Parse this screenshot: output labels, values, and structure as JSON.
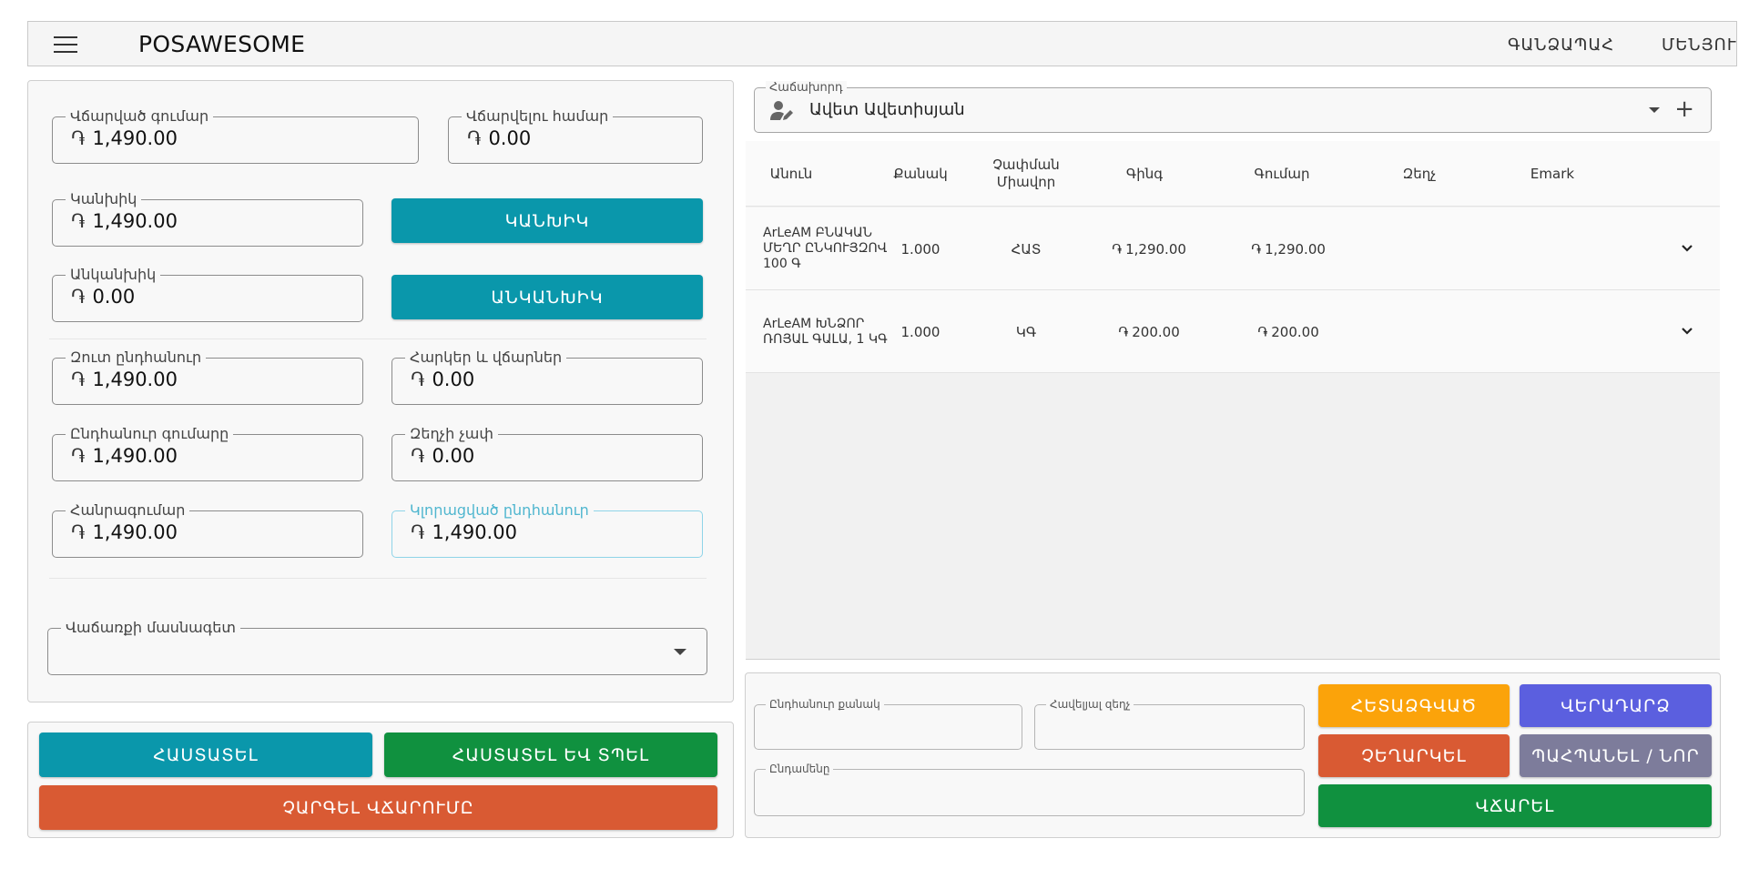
{
  "header": {
    "brand": "POSAWESOME",
    "nav": [
      "ԳԱՆՁԱՊԱՀ",
      "ՄԵՆՅՈՒ"
    ]
  },
  "payment": {
    "paid_amount": {
      "label": "Վճարված գումար",
      "value": "1,490.00"
    },
    "to_pay": {
      "label": "Վճարվելու համար",
      "value": "0.00"
    },
    "cash": {
      "label": "Կանխիկ",
      "value": "1,490.00",
      "button": "ԿԱՆԽԻԿ"
    },
    "noncash": {
      "label": "Անկանխիկ",
      "value": "0.00",
      "button": "ԱՆԿԱՆԽԻԿ"
    },
    "net_total": {
      "label": "Զուտ ընդհանուր",
      "value": "1,490.00"
    },
    "taxes": {
      "label": "Հարկեր և վճարներ",
      "value": "0.00"
    },
    "grand_total": {
      "label": "Ընդհանուր գումարը",
      "value": "1,490.00"
    },
    "discount": {
      "label": "Զեղչի չափ",
      "value": "0.00"
    },
    "total": {
      "label": "Հանրագումար",
      "value": "1,490.00"
    },
    "rounded_total": {
      "label": "Կլորացված ընդհանուր",
      "value": "1,490.00"
    },
    "salesperson": {
      "label": "Վաճառքի մասնագետ",
      "value": ""
    },
    "currency_symbol": "֏"
  },
  "payment_actions": {
    "submit": "ՀԱՍՏԱՏԵԼ",
    "submit_print": "ՀԱՍՏԱՏԵԼ ԵՎ ՏՊԵԼ",
    "cancel_payment": "ՉԱՐԳԵԼ ՎՃԱՐՈՒՄԸ"
  },
  "customer": {
    "label": "Հաճախորդ",
    "value": "Ավետ Ավետիսյան"
  },
  "items_table": {
    "headers": {
      "name": "Անուն",
      "qty": "Քանակ",
      "uom": "Չափման Միավոր",
      "rate": "Գինգ",
      "amount": "Գումար",
      "discount": "Զեղչ",
      "emark": "Emark"
    },
    "rows": [
      {
        "name": "ArLeAM ԲՆԱԿԱՆ ՄԵՂՐ ԸՆԿՈՒՅԶՈՎ 100 Գ",
        "qty": "1.000",
        "uom": "ՀԱՏ",
        "rate": "1,290.00",
        "amount": "1,290.00"
      },
      {
        "name": "ArLeAM ԽՆՁՈՐ ՌՈՅԱԼ ԳԱԼԱ, 1 ԿԳ",
        "qty": "1.000",
        "uom": "ԿԳ",
        "rate": "200.00",
        "amount": "200.00"
      }
    ]
  },
  "summary": {
    "total_qty_label": "Ընդհանուր քանակ",
    "additional_discount_label": "Հավելյալ զեղչ",
    "posting_date_label": "Ընդամենը"
  },
  "actions": {
    "hold": "ՀԵՏԱՁԳՎԱԾ",
    "return": "ՎԵՐԱԴԱՐՁ",
    "cancel": "ՉԵՂԱՐԿԵԼ",
    "save_new": "ՊԱՀՊԱՆԵԼ / ՆՈՐ",
    "pay": "ՎՃԱՐԵԼ"
  },
  "colors": {
    "teal": "#0a97ab",
    "green": "#10913f",
    "orange_red": "#d95a33",
    "amber": "#fba30a",
    "indigo": "#5b5fdf",
    "slate": "#7d7c9b"
  }
}
